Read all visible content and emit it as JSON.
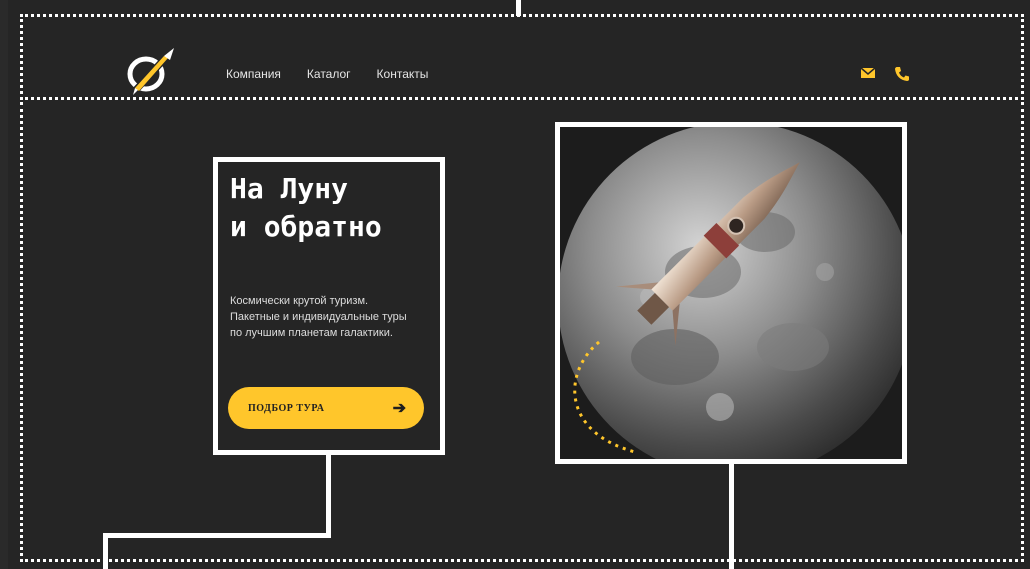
{
  "header": {
    "nav": [
      "Компания",
      "Каталог",
      "Контакты"
    ],
    "icons": [
      "rocket-logo-icon",
      "mail-icon",
      "phone-icon"
    ],
    "accent": "#ffc62b"
  },
  "hero": {
    "title_line1": "На Луну",
    "title_line2": "и обратно",
    "desc_line1": "Космически крутой туризм.",
    "desc_line2": "Пакетные и индивидуальные туры",
    "desc_line3": "по лучшим планетам галактики.",
    "cta_label": "ПОДБОР ТУРА",
    "cta_icon": "arrow-right-icon"
  },
  "image": {
    "subject": "moon-rocket-image"
  },
  "colors": {
    "background": "#252525",
    "annotation": "#ffffff",
    "text": "#e6e6e6"
  }
}
